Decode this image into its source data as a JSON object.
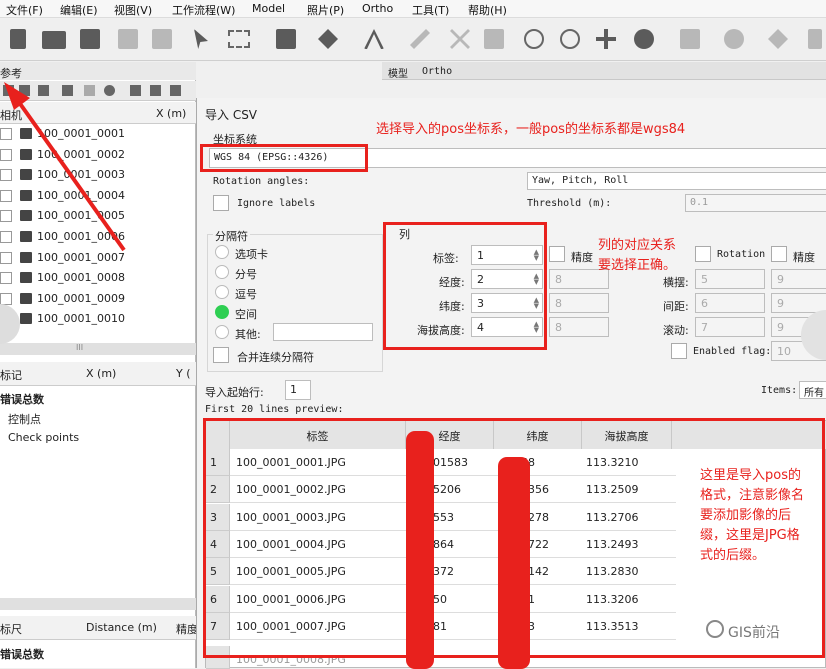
{
  "menu": [
    "文件(F)",
    "编辑(E)",
    "视图(V)",
    "工作流程(W)",
    "Model",
    "照片(P)",
    "Ortho",
    "工具(T)",
    "帮助(H)"
  ],
  "left_panel": {
    "title": "参考",
    "col_x": "X (m)",
    "col_header_left": "相机",
    "cameras": [
      "100_0001_0001",
      "100_0001_0002",
      "100_0001_0003",
      "100_0001_0004",
      "100_0001_0005",
      "100_0001_0006",
      "100_0001_0007",
      "100_0001_0008",
      "100_0001_0009",
      "100_0001_0010"
    ],
    "scroll_marker": "III",
    "markers_header": {
      "col0": "标记",
      "col1": "X (m)",
      "col2": "Y ("
    },
    "error_total": "错误总数",
    "control_points": "控制点",
    "check_points": "Check points",
    "scale_header": {
      "col0": "标尺",
      "col1": "Distance (m)",
      "col2": "精度"
    },
    "error_total_2": "错误总数"
  },
  "model_tabs": {
    "model": "模型",
    "ortho": "Ortho"
  },
  "dialog": {
    "title": "导入 CSV",
    "crs_section": "坐标系统",
    "crs_value": "WGS 84 (EPSG::4326)",
    "rotation_angles_label": "Rotation angles:",
    "rotation_angles_value": "Yaw, Pitch, Roll",
    "ignore_labels": "Ignore labels",
    "threshold_label": "Threshold (m):",
    "threshold_value": "0.1",
    "delimiter_section": "分隔符",
    "delimiters": [
      "选项卡",
      "分号",
      "逗号",
      "空间",
      "其他:"
    ],
    "delimiter_selected": 3,
    "merge_delimiters": "合并连续分隔符",
    "columns_section": "列",
    "col_label": {
      "label": "标签:",
      "value": "1"
    },
    "col_lon": {
      "label": "经度:",
      "value": "2"
    },
    "col_lat": {
      "label": "纬度:",
      "value": "3"
    },
    "col_alt": {
      "label": "海拔高度:",
      "value": "4"
    },
    "accuracy_label": "精度",
    "acc_values": [
      "8",
      "8",
      "8"
    ],
    "rotation_label": "Rotation",
    "accuracy_label_2": "精度",
    "yaw_label": "横摆:",
    "yaw_value": "5",
    "pitch_label": "间距:",
    "pitch_value": "6",
    "roll_label": "滚动:",
    "roll_value": "7",
    "rot_acc_values": [
      "9",
      "9",
      "9"
    ],
    "enabled_flag_label": "Enabled flag:",
    "enabled_flag_value": "10",
    "start_row_label": "导入起始行:",
    "start_row_value": "1",
    "items_label": "Items:",
    "items_value": "所有",
    "preview_label": "First 20 lines preview:",
    "grid_headers": [
      "标签",
      "经度",
      "纬度",
      "海拔高度"
    ],
    "grid_rows": [
      {
        "n": "1",
        "label": "100_0001_0001.JPG",
        "lon": "68101583",
        "lat": "46558",
        "alt": "113.3210"
      },
      {
        "n": "2",
        "label": "100_0001_0002.JPG",
        "lon": "8105206",
        "lat": "8448356",
        "alt": "113.2509"
      },
      {
        "n": "3",
        "label": "100_0001_0003.JPG",
        "lon": "122553",
        "lat": "8456278",
        "alt": "113.2706"
      },
      {
        "n": "4",
        "label": "100_0001_0004.JPG",
        "lon": "140864",
        "lat": "8464722",
        "alt": "113.2493"
      },
      {
        "n": "5",
        "label": "100_0001_0005.JPG",
        "lon": "159372",
        "lat": "8473142",
        "alt": "113.2830"
      },
      {
        "n": "6",
        "label": "100_0001_0006.JPG",
        "lon": "77850",
        "lat": "81611",
        "alt": "113.3206"
      },
      {
        "n": "7",
        "label": "100_0001_0007.JPG",
        "lon": "96481",
        "lat": "89953",
        "alt": "113.3513"
      }
    ],
    "row_8_label": "100_0001_0008.JPG"
  },
  "annotations": {
    "crs_note": "选择导入的pos坐标系，一般pos的坐标系都是wgs84",
    "columns_note": "列的对应关系要选择正确。",
    "format_note": "这里是导入pos的格式，注意影像名要添加影像的后缀，这里是JPG格式的后缀。"
  },
  "watermark": "GIS前沿",
  "colors": {
    "annotation_red": "#e8211d",
    "radio_selected": "#2fcf53"
  }
}
